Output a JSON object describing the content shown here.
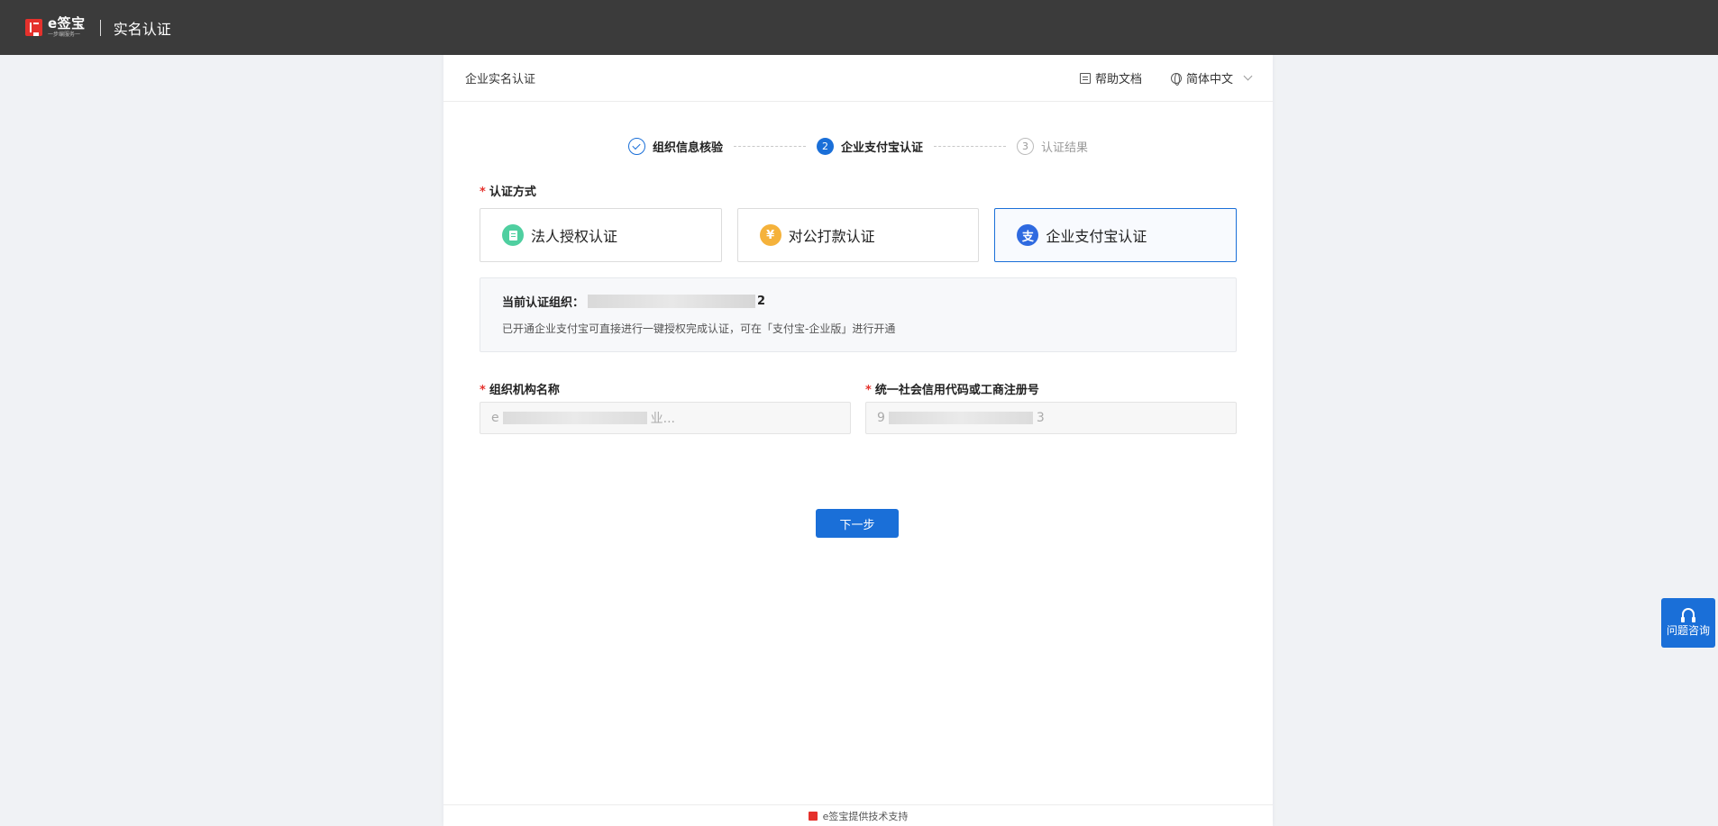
{
  "topbar": {
    "logo_text": "e签宝",
    "logo_sub": "一步编服务一",
    "title": "实名认证"
  },
  "card": {
    "title": "企业实名认证",
    "help_doc": "帮助文档",
    "language": "简体中文"
  },
  "steps": [
    {
      "label": "组织信息核验",
      "state": "done",
      "number": ""
    },
    {
      "label": "企业支付宝认证",
      "state": "active",
      "number": "2"
    },
    {
      "label": "认证结果",
      "state": "wait",
      "number": "3"
    }
  ],
  "auth_method": {
    "label": "认证方式",
    "options": [
      {
        "label": "法人授权认证",
        "icon": "document-icon",
        "color": "#4fcfa0"
      },
      {
        "label": "对公打款认证",
        "icon": "yuan-icon",
        "color": "#f5b23b",
        "glyph": "¥"
      },
      {
        "label": "企业支付宝认证",
        "icon": "alipay-icon",
        "color": "#2f6ae0",
        "glyph": "支",
        "selected": true
      }
    ]
  },
  "info": {
    "title_prefix": "当前认证组织：",
    "title_suffix": "2",
    "desc": "已开通企业支付宝可直接进行一键授权完成认证，可在「支付宝-企业版」进行开通"
  },
  "fields": {
    "org_name_label": "组织机构名称",
    "org_name_prefix": "e",
    "org_name_suffix": "业...",
    "credit_code_label": "统一社会信用代码或工商注册号",
    "credit_code_prefix": "9",
    "credit_code_suffix": "3"
  },
  "next_button": "下一步",
  "footer": "e签宝提供技术支持",
  "float_help": "问题咨询",
  "colors": {
    "primary": "#1a6fd8",
    "topbar": "#3b3b3b",
    "required": "#e5312c"
  }
}
